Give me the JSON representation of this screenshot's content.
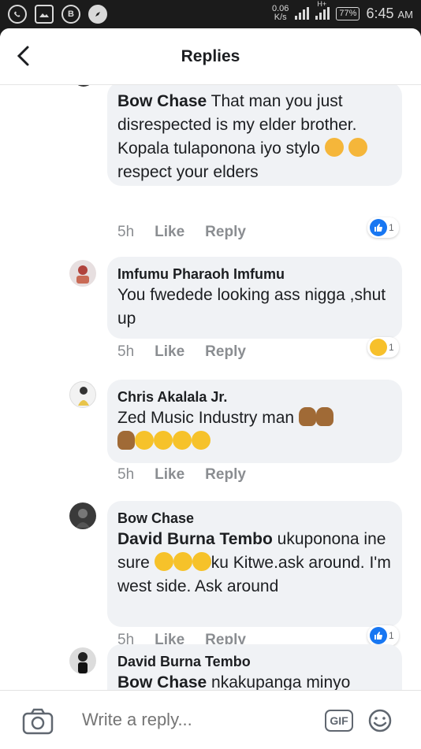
{
  "status_bar": {
    "net_speed_value": "0.06",
    "net_speed_unit": "K/s",
    "signal_label": "H+",
    "battery": "77%",
    "time": "6:45",
    "ampm": "AM",
    "left_icons": [
      "whatsapp-icon",
      "gallery-icon",
      "b-app-icon",
      "compass-icon"
    ],
    "b_app_letter": "B"
  },
  "header": {
    "title": "Replies"
  },
  "comments": [
    {
      "author": "Bow Chase",
      "text_parts": [
        "That man you just disrespected is my elder brother. Kopala tulaponona iyo stylo",
        "respect your elders"
      ],
      "time": "5h",
      "like": "Like",
      "reply": "Reply",
      "reaction": {
        "type": "like",
        "count": "1"
      }
    },
    {
      "author": "Imfumu Pharaoh Imfumu",
      "text": "You fwedede looking ass nigga ,shut up",
      "time": "5h",
      "like": "Like",
      "reply": "Reply",
      "reaction": {
        "type": "haha",
        "count": "1"
      }
    },
    {
      "author": "Chris Akalala Jr.",
      "text": "Zed Music Industry man",
      "time": "5h",
      "like": "Like",
      "reply": "Reply"
    },
    {
      "author": "Bow Chase",
      "mention": "David Burna Tembo",
      "text_a": "ukuponona ine sure",
      "text_b": "ku Kitwe.ask around. I'm west side. Ask around",
      "time": "5h",
      "like": "Like",
      "reply": "Reply",
      "reaction": {
        "type": "like",
        "count": "1"
      }
    },
    {
      "author": "David Burna Tembo",
      "mention": "Bow Chase",
      "text": "nkakupanga minyo"
    }
  ],
  "composer": {
    "placeholder": "Write a reply...",
    "gif_label": "GIF"
  },
  "colors": {
    "accent": "#1877f2",
    "bubble": "#f0f2f5",
    "meta_text": "#8a8d91"
  }
}
